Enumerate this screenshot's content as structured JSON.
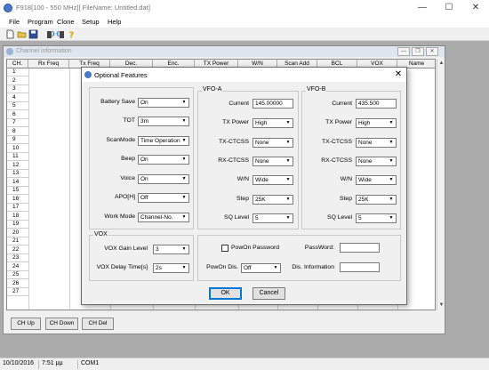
{
  "window": {
    "title": "F918[100 - 550 MHz][ FileName: Untitled.dat]",
    "min_glyph": "—",
    "max_glyph": "☐",
    "close_glyph": "✕"
  },
  "menu": [
    "File",
    "Program",
    "Clone",
    "Setup",
    "Help"
  ],
  "toolbar": {
    "icons": [
      "new-file-icon",
      "open-folder-icon",
      "save-disk-icon",
      "read-radio-icon",
      "write-radio-icon",
      "help-icon"
    ]
  },
  "channel_window": {
    "title": "Channel information",
    "columns": [
      "CH.",
      "Rx Freq",
      "Tx Freq",
      "Dec.",
      "Enc.",
      "TX Power",
      "W/N",
      "Scan Add",
      "BCL",
      "VOX",
      "Name"
    ],
    "rows": [
      "1",
      "2",
      "3",
      "4",
      "5",
      "6",
      "7",
      "8",
      "9",
      "10",
      "11",
      "12",
      "13",
      "14",
      "15",
      "16",
      "17",
      "18",
      "19",
      "20",
      "21",
      "22",
      "23",
      "24",
      "25",
      "26",
      "27"
    ],
    "buttons": {
      "up": "CH Up",
      "down": "CH Down",
      "del": "CH Del"
    }
  },
  "status_bar": {
    "date": "10/10/2016",
    "time": "7:51 μμ",
    "port": "COM1"
  },
  "dialog": {
    "title": "Optional Features",
    "close_glyph": "✕",
    "left_fields": [
      {
        "label": "Battery Save",
        "value": "On"
      },
      {
        "label": "TOT",
        "value": "3m"
      },
      {
        "label": "ScanMode",
        "value": "Time Operation"
      },
      {
        "label": "Beep",
        "value": "On"
      },
      {
        "label": "Voice",
        "value": "On"
      },
      {
        "label": "APO[H]",
        "value": "Off"
      },
      {
        "label": "Work Mode",
        "value": "Channel-No."
      }
    ],
    "vfo_a": {
      "caption": "VFO-A",
      "current_label": "Current",
      "current_value": "145.00000",
      "fields": [
        {
          "label": "TX Power",
          "value": "High"
        },
        {
          "label": "TX-CTCSS",
          "value": "None"
        },
        {
          "label": "RX-CTCSS",
          "value": "None"
        },
        {
          "label": "W/N",
          "value": "Wide"
        },
        {
          "label": "Step",
          "value": "25K"
        },
        {
          "label": "SQ Level",
          "value": "5"
        }
      ]
    },
    "vfo_b": {
      "caption": "VFO-B",
      "current_label": "Current",
      "current_value": "435.500",
      "fields": [
        {
          "label": "TX Power",
          "value": "High"
        },
        {
          "label": "TX-CTCSS",
          "value": "None"
        },
        {
          "label": "RX-CTCSS",
          "value": "None"
        },
        {
          "label": "W/N",
          "value": "Wide"
        },
        {
          "label": "Step",
          "value": "25K"
        },
        {
          "label": "SQ Level",
          "value": "5"
        }
      ]
    },
    "vox": {
      "caption": "VOX",
      "gain_label": "VOX Gain Level",
      "gain_value": "3",
      "delay_label": "VOX Delay Time[s]",
      "delay_value": "2s"
    },
    "power_on": {
      "password_check_label": "PowOn Password",
      "password_label": "PassWord:",
      "password_value": "",
      "display_label": "PowOn Dis.",
      "display_value": "Off",
      "info_label": "Dis. Information",
      "info_value": ""
    },
    "ok_label": "OK",
    "cancel_label": "Cancel"
  }
}
